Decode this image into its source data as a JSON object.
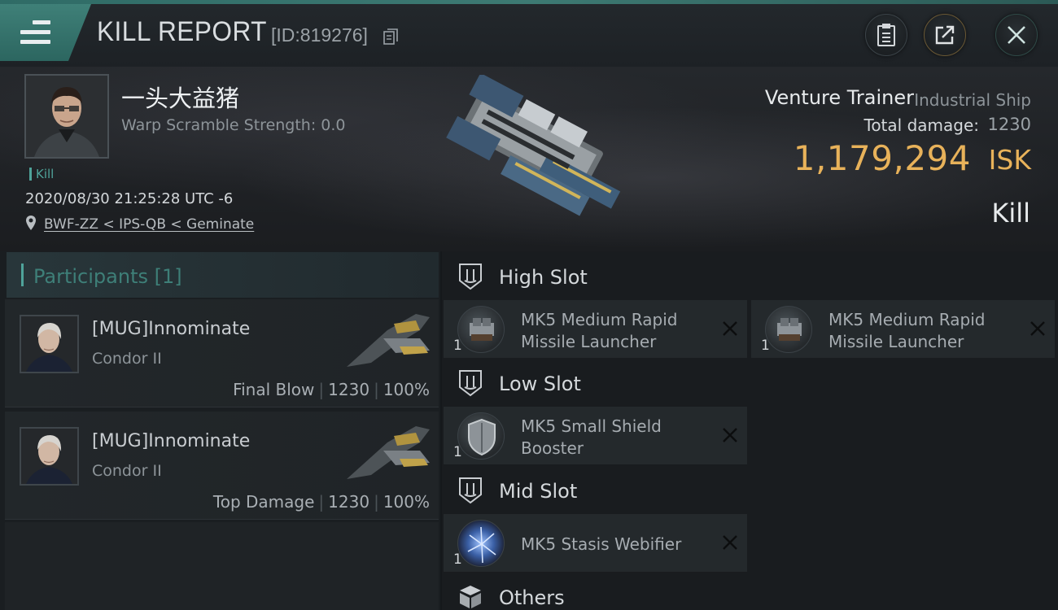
{
  "header": {
    "title": "KILL REPORT",
    "report_id": "[ID:819276]"
  },
  "victim": {
    "name": "一头大益猪",
    "warp_scramble": "Warp Scramble Strength: 0.0",
    "tag": "Kill",
    "timestamp": "2020/08/30 21:25:28 UTC -6",
    "location": "BWF-ZZ < IPS-QB < Geminate"
  },
  "ship": {
    "name": "Venture Trainer",
    "class": "Industrial Ship",
    "total_damage_label": "Total damage:",
    "total_damage_value": "1230",
    "isk_value": "1,179,294",
    "isk_unit": "ISK",
    "result": "Kill"
  },
  "participants": {
    "label": "Participants [1]",
    "rows": [
      {
        "name": "[MUG]Innominate",
        "ship": "Condor II",
        "role": "Final Blow",
        "damage": "1230",
        "percent": "100%"
      },
      {
        "name": "[MUG]Innominate",
        "ship": "Condor II",
        "role": "Top Damage",
        "damage": "1230",
        "percent": "100%"
      }
    ]
  },
  "slots": {
    "high": {
      "label": "High Slot",
      "modules": [
        {
          "name": "MK5 Medium Rapid Missile Launcher",
          "qty": "1"
        },
        {
          "name": "MK5 Medium Rapid Missile Launcher",
          "qty": "1"
        }
      ]
    },
    "low": {
      "label": "Low Slot",
      "modules": [
        {
          "name": "MK5 Small Shield Booster",
          "qty": "1"
        }
      ]
    },
    "mid": {
      "label": "Mid Slot",
      "modules": [
        {
          "name": "MK5 Stasis Webifier",
          "qty": "1"
        }
      ]
    },
    "others": {
      "label": "Others"
    }
  },
  "colors": {
    "accent": "#4fa39a",
    "isk": "#e8b25a",
    "header_tab": "#3f8078"
  }
}
